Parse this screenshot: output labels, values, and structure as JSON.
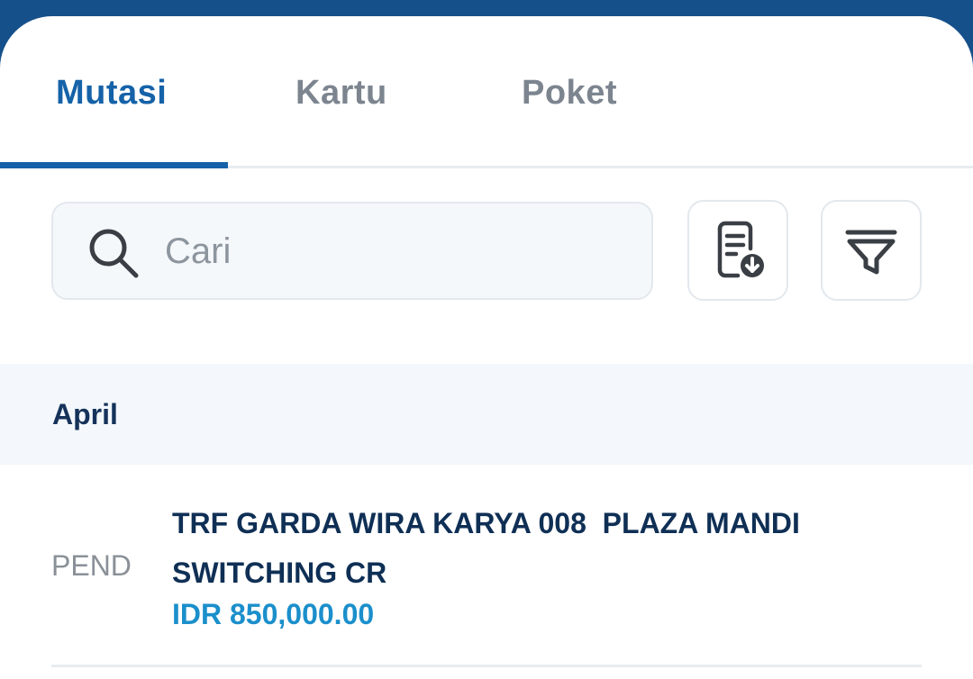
{
  "tabs": [
    {
      "label": "Mutasi",
      "active": true
    },
    {
      "label": "Kartu",
      "active": false
    },
    {
      "label": "Poket",
      "active": false
    }
  ],
  "search": {
    "placeholder": "Cari",
    "value": ""
  },
  "toolbar": {
    "download_icon": "document-download-icon",
    "filter_icon": "filter-icon"
  },
  "month": "April",
  "transactions": [
    {
      "status": "PEND",
      "description": "TRF GARDA WIRA KARYA 008  PLAZA MANDI SWITCHING CR",
      "amount": "IDR 850,000.00"
    }
  ],
  "colors": {
    "brand": "#16508a",
    "accent": "#1562a8",
    "amount": "#1b8fcb",
    "text_dark": "#0f2f55",
    "muted": "#7c858f"
  }
}
